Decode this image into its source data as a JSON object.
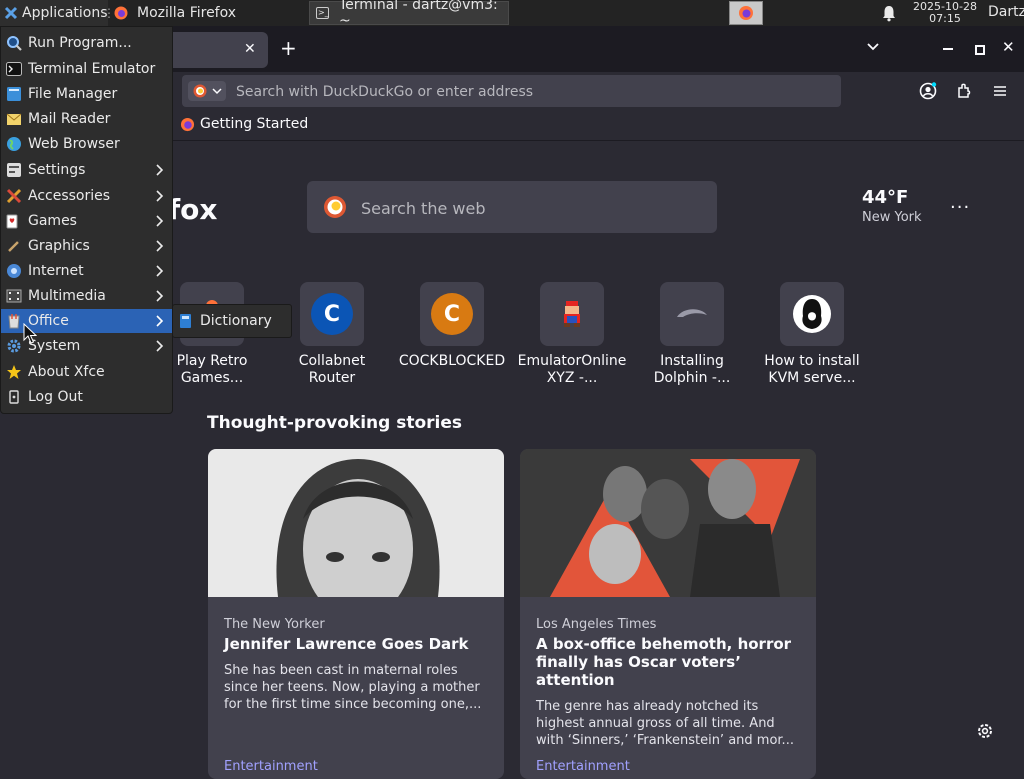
{
  "panel": {
    "applications_label": "Applications",
    "separator": "⋮",
    "tasks": [
      {
        "label": "Mozilla Firefox"
      },
      {
        "label": "Terminal - dartz@vm3: ~"
      }
    ],
    "clock_date": "2025-10-28",
    "clock_time": "07:15",
    "user": "Dartz"
  },
  "browser": {
    "url_placeholder": "Search with DuckDuckGo or enter address",
    "bookmarks": [
      {
        "label": "Getting Started"
      }
    ]
  },
  "newtab": {
    "brand_partial": "fox",
    "search_placeholder": "Search the web",
    "weather": {
      "temp": "44°F",
      "city": "New York",
      "more": "···"
    },
    "shortcuts": [
      {
        "label": "Play Retro Games..."
      },
      {
        "label": "Collabnet Router",
        "letter": "C"
      },
      {
        "label": "COCKBLOCKED",
        "letter": "C"
      },
      {
        "label": "EmulatorOnline XYZ -..."
      },
      {
        "label": "Installing Dolphin -..."
      },
      {
        "label": "How to install KVM serve..."
      }
    ],
    "stories_title": "Thought-provoking stories",
    "stories": [
      {
        "source": "The New Yorker",
        "headline": "Jennifer Lawrence Goes Dark",
        "excerpt": "She has been cast in maternal roles since her teens. Now, playing a mother for the first time since becoming one,...",
        "category": "Entertainment"
      },
      {
        "source": "Los Angeles Times",
        "headline": "A box-office behemoth, horror finally has Oscar voters’ attention",
        "excerpt": "The genre has already notched its highest annual gross of all time. And with ‘Sinners,’ ‘Frankenstein’ and mor...",
        "category": "Entertainment"
      }
    ]
  },
  "menu": {
    "items": [
      {
        "label": "Run Program...",
        "icon": "run-icon"
      },
      {
        "label": "Terminal Emulator",
        "icon": "terminal-icon"
      },
      {
        "label": "File Manager",
        "icon": "file-manager-icon"
      },
      {
        "label": "Mail Reader",
        "icon": "mail-icon"
      },
      {
        "label": "Web Browser",
        "icon": "globe-icon"
      },
      {
        "label": "Settings",
        "icon": "settings-icon",
        "submenu": true
      },
      {
        "label": "Accessories",
        "icon": "accessories-icon",
        "submenu": true
      },
      {
        "label": "Games",
        "icon": "games-icon",
        "submenu": true
      },
      {
        "label": "Graphics",
        "icon": "graphics-icon",
        "submenu": true
      },
      {
        "label": "Internet",
        "icon": "internet-icon",
        "submenu": true
      },
      {
        "label": "Multimedia",
        "icon": "multimedia-icon",
        "submenu": true
      },
      {
        "label": "Office",
        "icon": "office-icon",
        "submenu": true,
        "highlighted": true
      },
      {
        "label": "System",
        "icon": "system-icon",
        "submenu": true
      },
      {
        "label": "About Xfce",
        "icon": "star-icon"
      },
      {
        "label": "Log Out",
        "icon": "logout-icon"
      }
    ],
    "office_submenu": [
      {
        "label": "Dictionary",
        "icon": "dictionary-icon"
      }
    ]
  },
  "colors": {
    "accent": "#2b63b5",
    "background": "#2b2a33",
    "card": "#42414d",
    "link": "#a1a1ff"
  }
}
